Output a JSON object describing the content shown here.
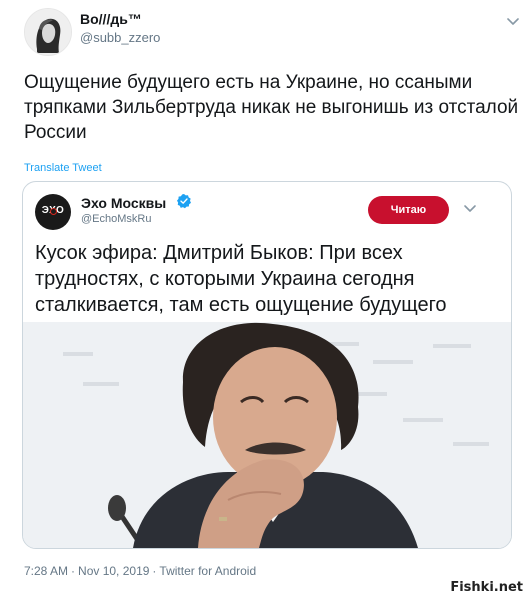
{
  "tweet": {
    "author_name": "Во///дь™",
    "author_handle": "@subb_zzero",
    "text": "Ощущение будущего есть на Украине, но ссаными тряпками Зильбертруда никак не выгонишь из отсталой России",
    "translate_label": "Translate Tweet",
    "icons": {
      "avatar": "portrait-avatar",
      "menu": "chevron-down-icon"
    }
  },
  "quoted": {
    "author_name": "Эхо Москвы",
    "author_handle": "@EchoMskRu",
    "avatar_text": "ЭХО",
    "read_label": "Читаю",
    "text": "Кусок эфира: Дмитрий Быков: При всех трудностях, с которыми Украина сегодня сталкивается, там есть ощущение будущего",
    "icons": {
      "verified": "verified-badge-icon",
      "menu": "chevron-down-icon",
      "photo": "news-photo"
    },
    "colors": {
      "read_button": "#c8102e",
      "verified": "#1da1f2"
    }
  },
  "meta": {
    "time": "7:28 AM",
    "date": "Nov 10, 2019",
    "source": "Twitter for Android"
  },
  "watermark": "Fishki.net",
  "colors": {
    "link": "#1da1f2",
    "muted": "#657786",
    "text": "#14171a",
    "border": "#ccd6dd"
  }
}
